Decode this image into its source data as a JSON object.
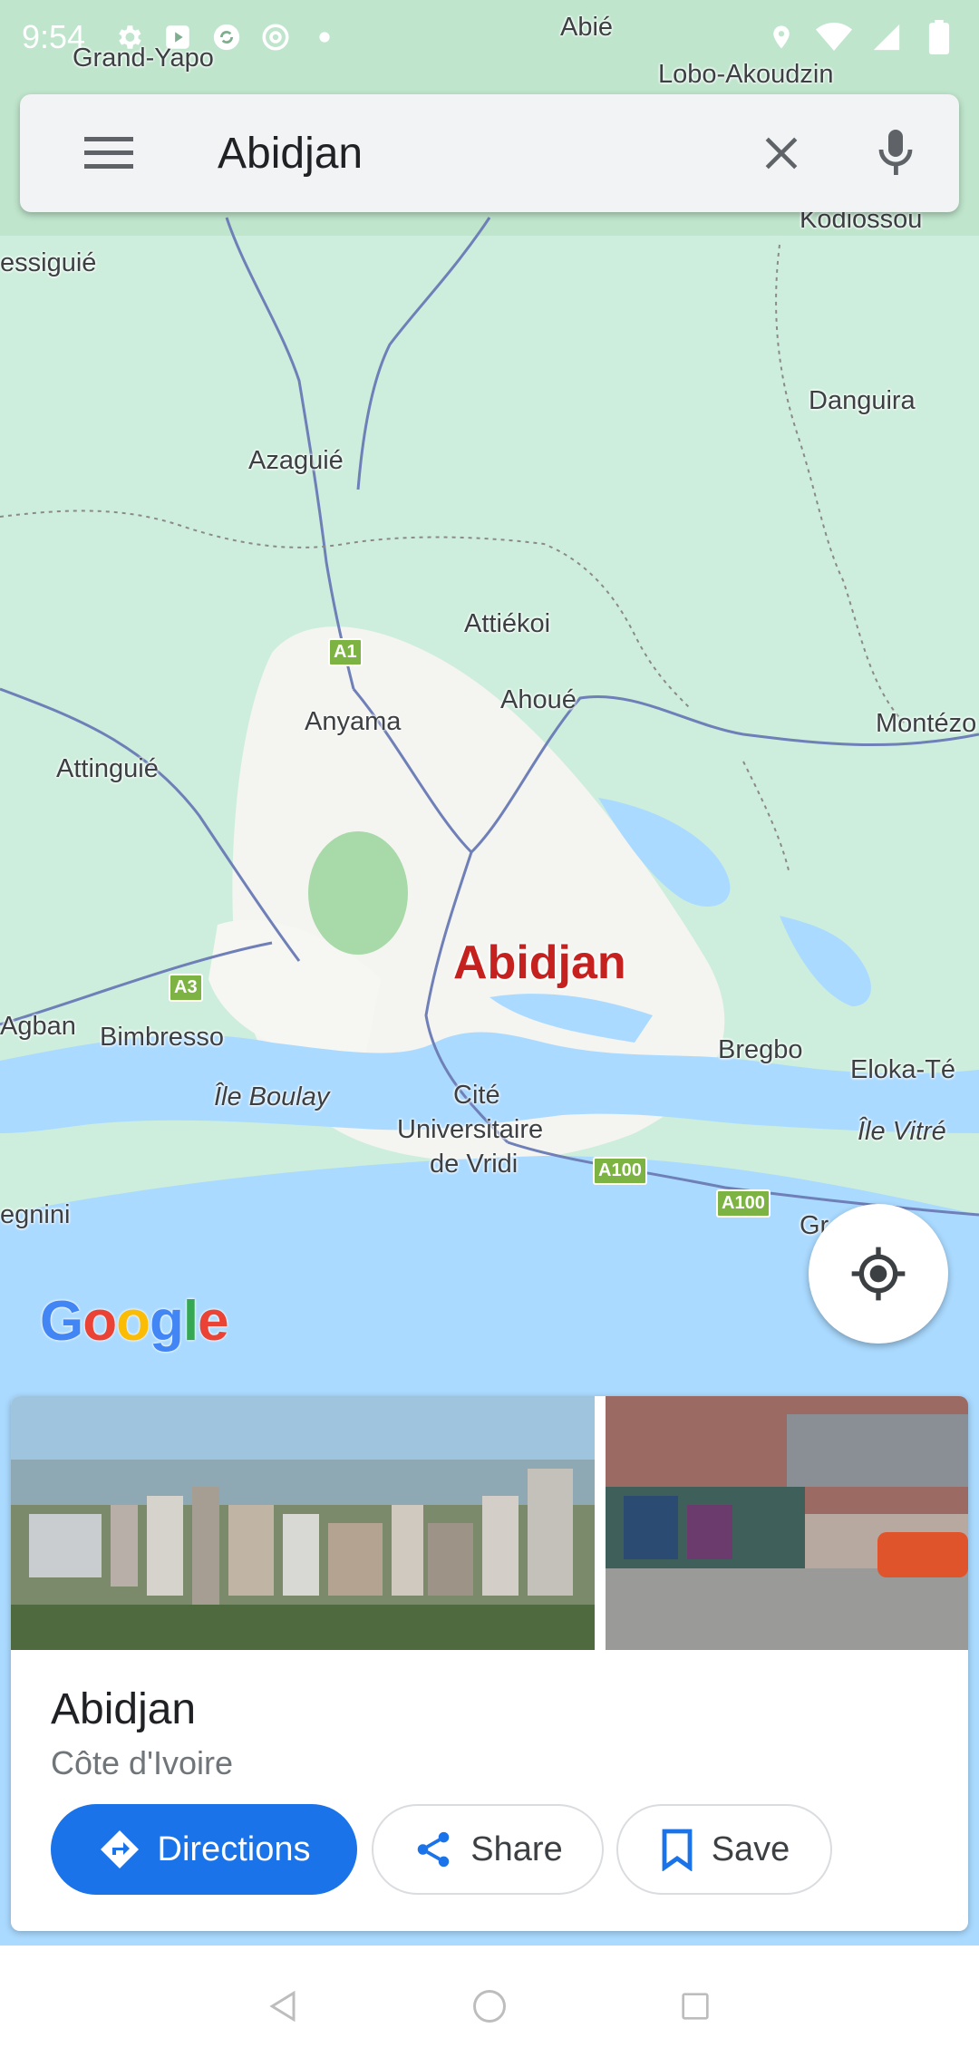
{
  "status_bar": {
    "time": "9:54"
  },
  "search": {
    "query": "Abidjan"
  },
  "map": {
    "city_label": "Abidjan",
    "places": [
      {
        "id": "abie",
        "label": "Abié"
      },
      {
        "id": "grand-yapo",
        "label": "Grand-Yapo"
      },
      {
        "id": "lobo-akoudzin",
        "label": "Lobo-Akoudzin"
      },
      {
        "id": "kodiossou",
        "label": "Kodiossou"
      },
      {
        "id": "essiguie",
        "label": "essiguié"
      },
      {
        "id": "danguira",
        "label": "Danguira"
      },
      {
        "id": "azaguie",
        "label": "Azaguié"
      },
      {
        "id": "attiekoi",
        "label": "Attiékoi"
      },
      {
        "id": "ahoue",
        "label": "Ahoué"
      },
      {
        "id": "anyama",
        "label": "Anyama"
      },
      {
        "id": "montezo",
        "label": "Montézo"
      },
      {
        "id": "attinguie",
        "label": "Attinguié"
      },
      {
        "id": "agban",
        "label": "Agban"
      },
      {
        "id": "bimbresso",
        "label": "Bimbresso"
      },
      {
        "id": "bregbo",
        "label": "Bregbo"
      },
      {
        "id": "eloka-te",
        "label": "Eloka-Té"
      },
      {
        "id": "ile-boulay",
        "label": "Île Boulay"
      },
      {
        "id": "cite",
        "label": "Cité"
      },
      {
        "id": "universitaire",
        "label": "Universitaire"
      },
      {
        "id": "de-vridi",
        "label": "de Vridi"
      },
      {
        "id": "ile-vitre",
        "label": "Île Vitré"
      },
      {
        "id": "egnini",
        "label": "egnini"
      },
      {
        "id": "grand-bassam",
        "label": "Gr      ssam"
      }
    ],
    "road_shields": [
      {
        "id": "a1",
        "label": "A1"
      },
      {
        "id": "a3",
        "label": "A3"
      },
      {
        "id": "a100-1",
        "label": "A100"
      },
      {
        "id": "a100-2",
        "label": "A100"
      }
    ],
    "logo": "Google"
  },
  "place_card": {
    "name": "Abidjan",
    "country": "Côte d'Ivoire",
    "buttons": {
      "directions": "Directions",
      "share": "Share",
      "save": "Save"
    }
  },
  "colors": {
    "primary_blue": "#1a73e8",
    "city_red": "#c5221f",
    "water": "#aadaff",
    "land": "#c8ecd6"
  }
}
